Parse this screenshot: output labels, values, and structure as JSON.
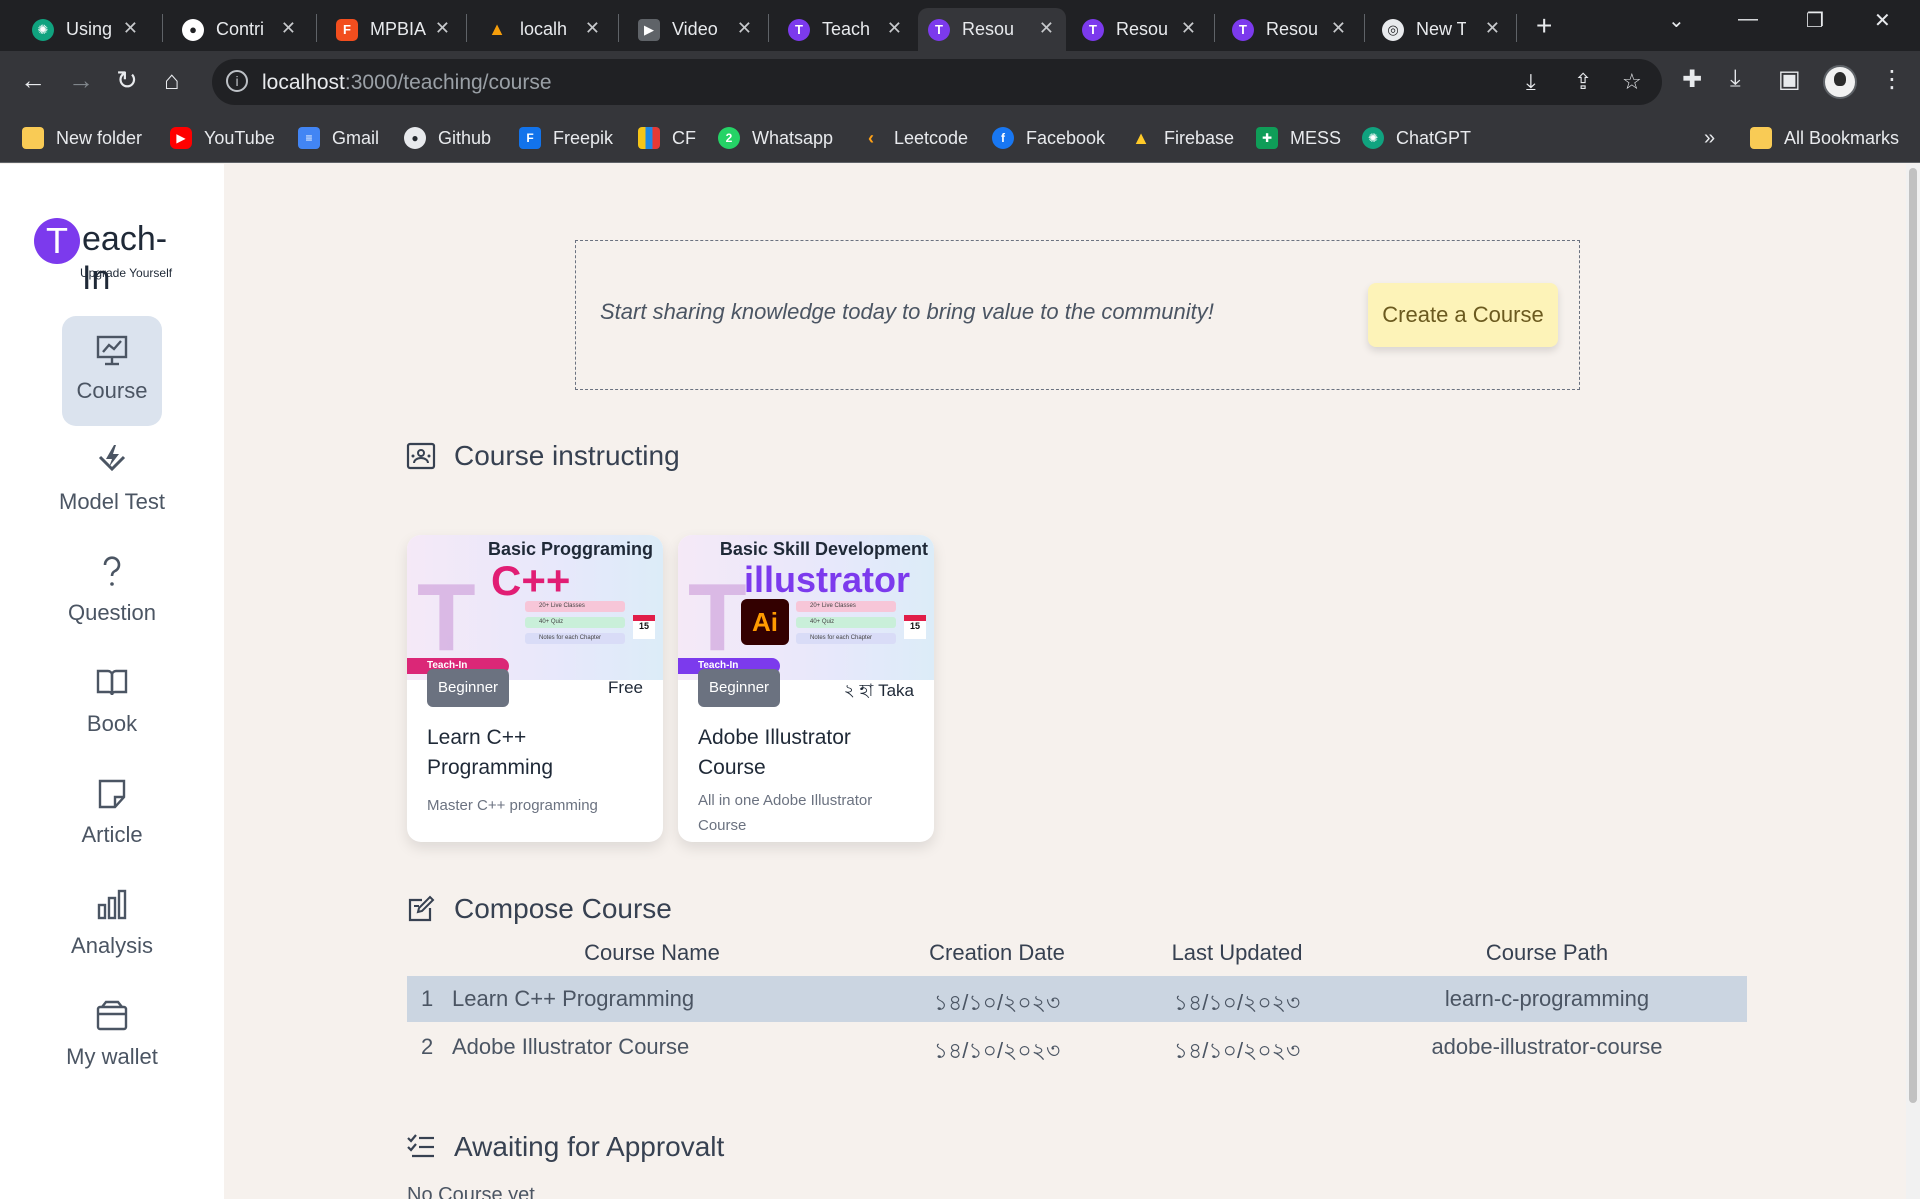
{
  "browser": {
    "tabs": [
      {
        "title": "Using",
        "icon": "chatgpt-icon",
        "color": "#10a37f"
      },
      {
        "title": "Contri",
        "icon": "github-icon",
        "color": "#ffffff"
      },
      {
        "title": "MPBIA",
        "icon": "figma-icon",
        "color": "#f24e1e"
      },
      {
        "title": "localh",
        "icon": "mountain-logo-icon",
        "color": "#f59e0b"
      },
      {
        "title": "Video",
        "icon": "video-icon",
        "color": "#9aa0a6"
      },
      {
        "title": "Teach",
        "icon": "teach-in-icon",
        "color": "#7c3aed"
      },
      {
        "title": "Resou",
        "icon": "teach-in-icon",
        "color": "#7c3aed",
        "active": true
      },
      {
        "title": "Resou",
        "icon": "teach-in-icon",
        "color": "#7c3aed"
      },
      {
        "title": "Resou",
        "icon": "teach-in-icon",
        "color": "#7c3aed"
      },
      {
        "title": "New T",
        "icon": "chrome-icon",
        "color": "#e8eaed"
      }
    ],
    "url_host": "localhost",
    "url_path": ":3000/teaching/course",
    "bookmarks": [
      {
        "label": "New folder",
        "icon": "folder-icon",
        "color": "#f9cb55"
      },
      {
        "label": "YouTube",
        "icon": "youtube-icon",
        "color": "#ff0000"
      },
      {
        "label": "Gmail",
        "icon": "docs-icon",
        "color": "#4285f4"
      },
      {
        "label": "Github",
        "icon": "github-icon",
        "color": "#24292f"
      },
      {
        "label": "Freepik",
        "icon": "freepik-icon",
        "color": "#1273eb"
      },
      {
        "label": "CF",
        "icon": "codeforces-icon",
        "color": "#f5c518"
      },
      {
        "label": "Whatsapp",
        "icon": "whatsapp-icon",
        "color": "#25d366"
      },
      {
        "label": "Leetcode",
        "icon": "leetcode-icon",
        "color": "#ffa116"
      },
      {
        "label": "Facebook",
        "icon": "facebook-icon",
        "color": "#1877f2"
      },
      {
        "label": "Firebase",
        "icon": "firebase-icon",
        "color": "#ffca28"
      },
      {
        "label": "MESS",
        "icon": "sheets-icon",
        "color": "#0f9d58"
      },
      {
        "label": "ChatGPT",
        "icon": "chatgpt-icon",
        "color": "#10a37f"
      }
    ],
    "bookmarks_more": "»",
    "all_bookmarks": "All Bookmarks"
  },
  "sidebar": {
    "logo_letter": "T",
    "logo_word": "each-In",
    "logo_tagline": "Upgrade Yourself",
    "items": [
      {
        "label": "Course",
        "icon": "presentation-icon",
        "active": true
      },
      {
        "label": "Model Test",
        "icon": "test-icon"
      },
      {
        "label": "Question",
        "icon": "question-icon"
      },
      {
        "label": "Book",
        "icon": "book-icon"
      },
      {
        "label": "Article",
        "icon": "note-icon"
      },
      {
        "label": "Analysis",
        "icon": "bar-chart-icon"
      },
      {
        "label": "My wallet",
        "icon": "wallet-icon"
      }
    ]
  },
  "banner": {
    "message": "Start sharing knowledge today to bring value to the community!",
    "button": "Create a Course"
  },
  "sections": {
    "instructing": "Course instructing",
    "compose": "Compose Course",
    "awaiting": "Awaiting for Approvalt",
    "awaiting_empty": "No Course yet"
  },
  "courses": [
    {
      "thumb_heading": "Basic Proggraming",
      "thumb_big": "C++",
      "thumb_brand": "Teach-In",
      "thumb_features": [
        "20+ Live Classes",
        "40+ Quiz",
        "Notes for each Chapter"
      ],
      "thumb_date_month": "Nov",
      "thumb_date_day": "15",
      "level": "Beginner",
      "price": "Free",
      "title": "Learn C++ Programming",
      "description": "Master C++ programming"
    },
    {
      "thumb_heading": "Basic Skill Development",
      "thumb_big": "illustrator",
      "thumb_logo": "Ai",
      "thumb_brand": "Teach-In",
      "thumb_features": [
        "20+ Live Classes",
        "40+ Quiz",
        "Notes for each Chapter"
      ],
      "thumb_date_month": "Nov",
      "thumb_date_day": "15",
      "level": "Beginner",
      "price": "২ হা Taka",
      "title": "Adobe Illustrator Course",
      "description": "All in one Adobe Illustrator Course"
    }
  ],
  "table": {
    "headers": [
      "Course Name",
      "Creation Date",
      "Last Updated",
      "Course Path"
    ],
    "rows": [
      {
        "index": "1",
        "name": "Learn C++ Programming",
        "created": "১৪/১০/২০২৩",
        "updated": "১৪/১০/২০২৩",
        "path": "learn-c-programming"
      },
      {
        "index": "2",
        "name": "Adobe Illustrator Course",
        "created": "১৪/১০/২০২৩",
        "updated": "১৪/১০/২০২৩",
        "path": "adobe-illustrator-course"
      }
    ]
  },
  "colors": {
    "accent": "#7c3aed",
    "page_bg": "#f6f1ed",
    "cta_bg": "#fdf3b8",
    "row_highlight": "#cbd5e1"
  }
}
